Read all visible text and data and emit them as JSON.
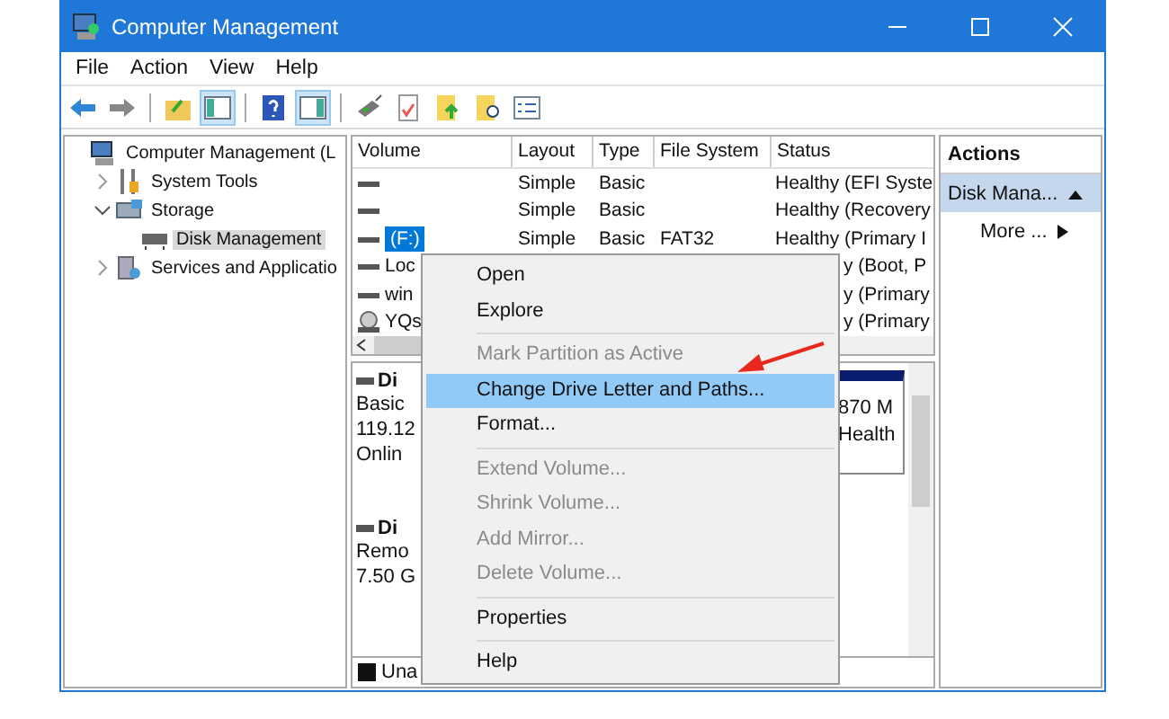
{
  "window": {
    "title": "Computer Management"
  },
  "menu_bar": [
    "File",
    "Action",
    "View",
    "Help"
  ],
  "toolbar": [
    {
      "kind": "back",
      "pressed": false
    },
    {
      "kind": "forward",
      "pressed": false
    },
    {
      "kind": "sep"
    },
    {
      "kind": "up",
      "pressed": false
    },
    {
      "kind": "tree",
      "pressed": true
    },
    {
      "kind": "sep"
    },
    {
      "kind": "help",
      "pressed": false
    },
    {
      "kind": "pane",
      "pressed": true
    },
    {
      "kind": "sep"
    },
    {
      "kind": "connect",
      "pressed": false
    },
    {
      "kind": "check",
      "pressed": false
    },
    {
      "kind": "folder",
      "pressed": false
    },
    {
      "kind": "search",
      "pressed": false
    },
    {
      "kind": "list",
      "pressed": false
    }
  ],
  "tree": [
    {
      "label": "Computer Management (L",
      "kind": "computer",
      "selected": false,
      "children": [
        {
          "label": "System Tools",
          "kind": "tools",
          "expanded": false,
          "selected": false
        },
        {
          "label": "Storage",
          "kind": "storage",
          "expanded": true,
          "selected": false,
          "children": [
            {
              "label": "Disk Management",
              "kind": "disk",
              "selected": true
            }
          ]
        },
        {
          "label": "Services and Applicatio",
          "kind": "services",
          "expanded": false,
          "selected": false
        }
      ]
    }
  ],
  "volume_table": {
    "columns": [
      "Volume",
      "Layout",
      "Type",
      "File System",
      "Status"
    ],
    "rows": [
      {
        "kind": "drive",
        "selected": false,
        "covered": false,
        "cells": [
          "",
          "Simple",
          "Basic",
          "",
          "Healthy (EFI Syste"
        ]
      },
      {
        "kind": "drive",
        "selected": false,
        "covered": false,
        "cells": [
          "",
          "Simple",
          "Basic",
          "",
          "Healthy (Recovery"
        ]
      },
      {
        "kind": "drive",
        "selected": true,
        "covered": false,
        "cells": [
          "(F:)",
          "Simple",
          "Basic",
          "FAT32",
          "Healthy (Primary I"
        ]
      },
      {
        "kind": "drive",
        "selected": false,
        "covered": true,
        "cells": [
          "Loc",
          "",
          "",
          "",
          "y (Boot, P"
        ]
      },
      {
        "kind": "drive",
        "selected": false,
        "covered": true,
        "cells": [
          "win",
          "",
          "",
          "",
          "y (Primary"
        ]
      },
      {
        "kind": "disc",
        "selected": false,
        "covered": true,
        "cells": [
          "YQs",
          "",
          "",
          "",
          "y (Primary"
        ]
      }
    ]
  },
  "disks": [
    {
      "name": "Di",
      "lines": [
        "Basic",
        "119.12",
        "Onlin"
      ],
      "partition": [
        "870 M",
        "Health"
      ]
    },
    {
      "name": "Di",
      "lines": [
        "Remo",
        "7.50 G"
      ]
    }
  ],
  "legend": [
    {
      "label": "Una",
      "color": "#111111"
    }
  ],
  "context_menu": [
    {
      "kind": "item",
      "label": "Open",
      "disabled": false,
      "selected": false
    },
    {
      "kind": "item",
      "label": "Explore",
      "disabled": false,
      "selected": false
    },
    {
      "kind": "separator"
    },
    {
      "kind": "item",
      "label": "Mark Partition as Active",
      "disabled": true,
      "selected": false
    },
    {
      "kind": "item",
      "label": "Change Drive Letter and Paths...",
      "disabled": false,
      "selected": true
    },
    {
      "kind": "item",
      "label": "Format...",
      "disabled": false,
      "selected": false
    },
    {
      "kind": "separator"
    },
    {
      "kind": "item",
      "label": "Extend Volume...",
      "disabled": true,
      "selected": false
    },
    {
      "kind": "item",
      "label": "Shrink Volume...",
      "disabled": true,
      "selected": false
    },
    {
      "kind": "item",
      "label": "Add Mirror...",
      "disabled": true,
      "selected": false
    },
    {
      "kind": "item",
      "label": "Delete Volume...",
      "disabled": true,
      "selected": false
    },
    {
      "kind": "separator"
    },
    {
      "kind": "item",
      "label": "Properties",
      "disabled": false,
      "selected": false
    },
    {
      "kind": "separator"
    },
    {
      "kind": "item",
      "label": "Help",
      "disabled": false,
      "selected": false
    }
  ],
  "actions": {
    "title": "Actions",
    "items": [
      {
        "label": "Disk Mana...",
        "kind": "group",
        "selected": true
      },
      {
        "label": "More ...",
        "kind": "submenu",
        "selected": false
      }
    ]
  }
}
